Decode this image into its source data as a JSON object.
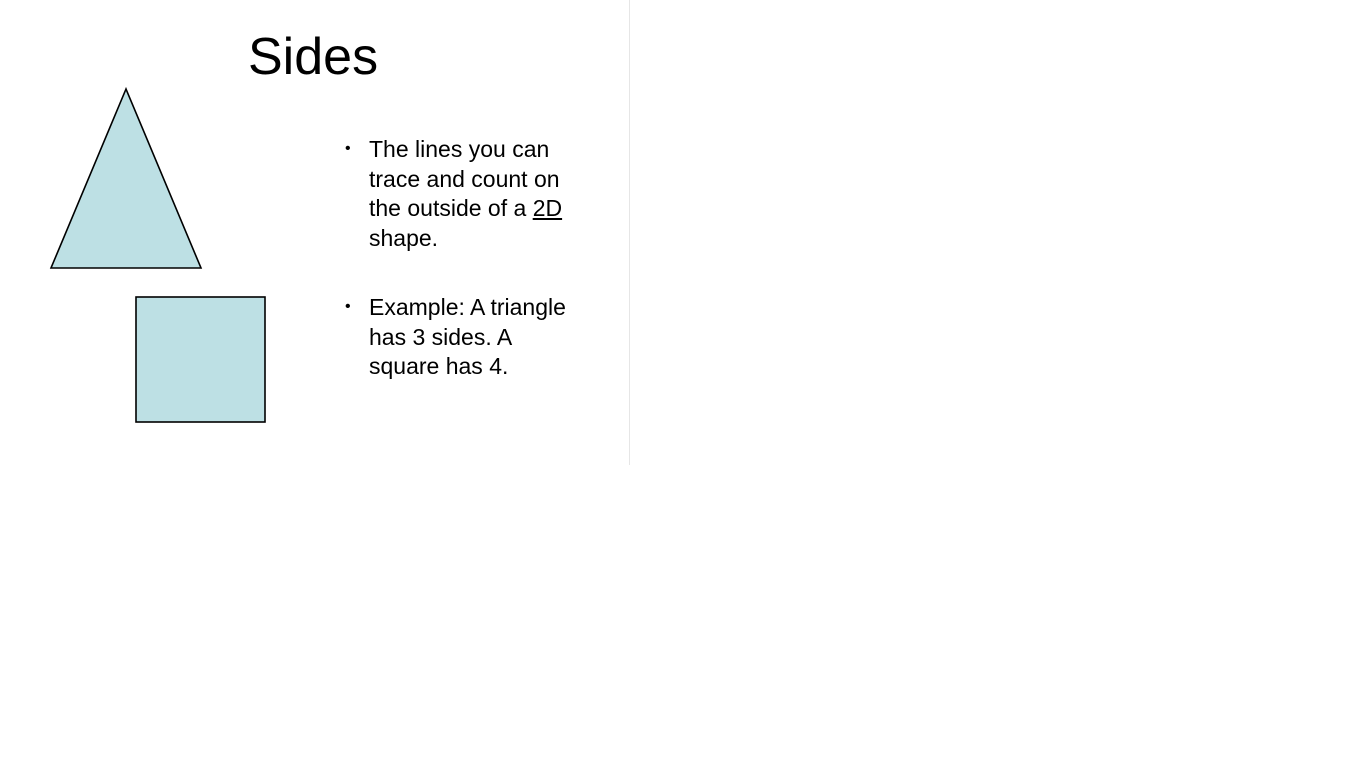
{
  "slide": {
    "title": "Sides",
    "bullets": [
      {
        "before": "The lines you can trace and count on the outside of a ",
        "underlined": "2D",
        "after": " shape."
      },
      {
        "text": "Example: A triangle has 3 sides. A square has 4."
      }
    ],
    "bullet_glyph": "•"
  },
  "colors": {
    "shape_fill": "#bde0e4",
    "shape_stroke": "#000000",
    "text": "#000000",
    "background": "#ffffff"
  },
  "icons": {
    "triangle": "triangle-shape",
    "square": "square-shape"
  }
}
